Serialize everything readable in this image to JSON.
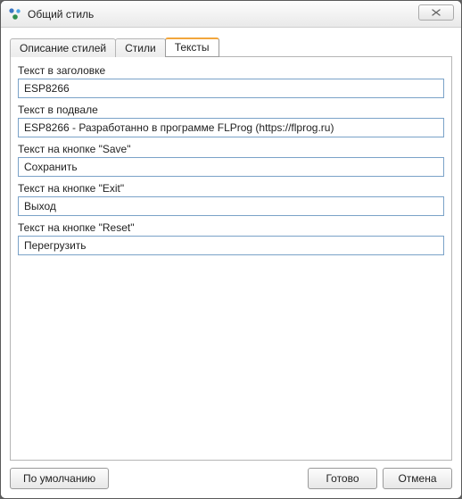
{
  "window": {
    "title": "Общий стиль"
  },
  "tabs": {
    "t0": "Описание стилей",
    "t1": "Стили",
    "t2": "Тексты"
  },
  "labels": {
    "header": "Текст в заголовке",
    "footer": "Текст в подвале",
    "save": "Текст на кнопке \"Save\"",
    "exit": "Текст на кнопке \"Exit\"",
    "reset": "Текст на кнопке \"Reset\""
  },
  "values": {
    "header": "ESP8266",
    "footer": "ESP8266 - Разработанно в программе FLProg (https://flprog.ru)",
    "save": "Сохранить",
    "exit": "Выход",
    "reset": "Перегрузить"
  },
  "buttons": {
    "defaults": "По умолчанию",
    "ok": "Готово",
    "cancel": "Отмена"
  }
}
